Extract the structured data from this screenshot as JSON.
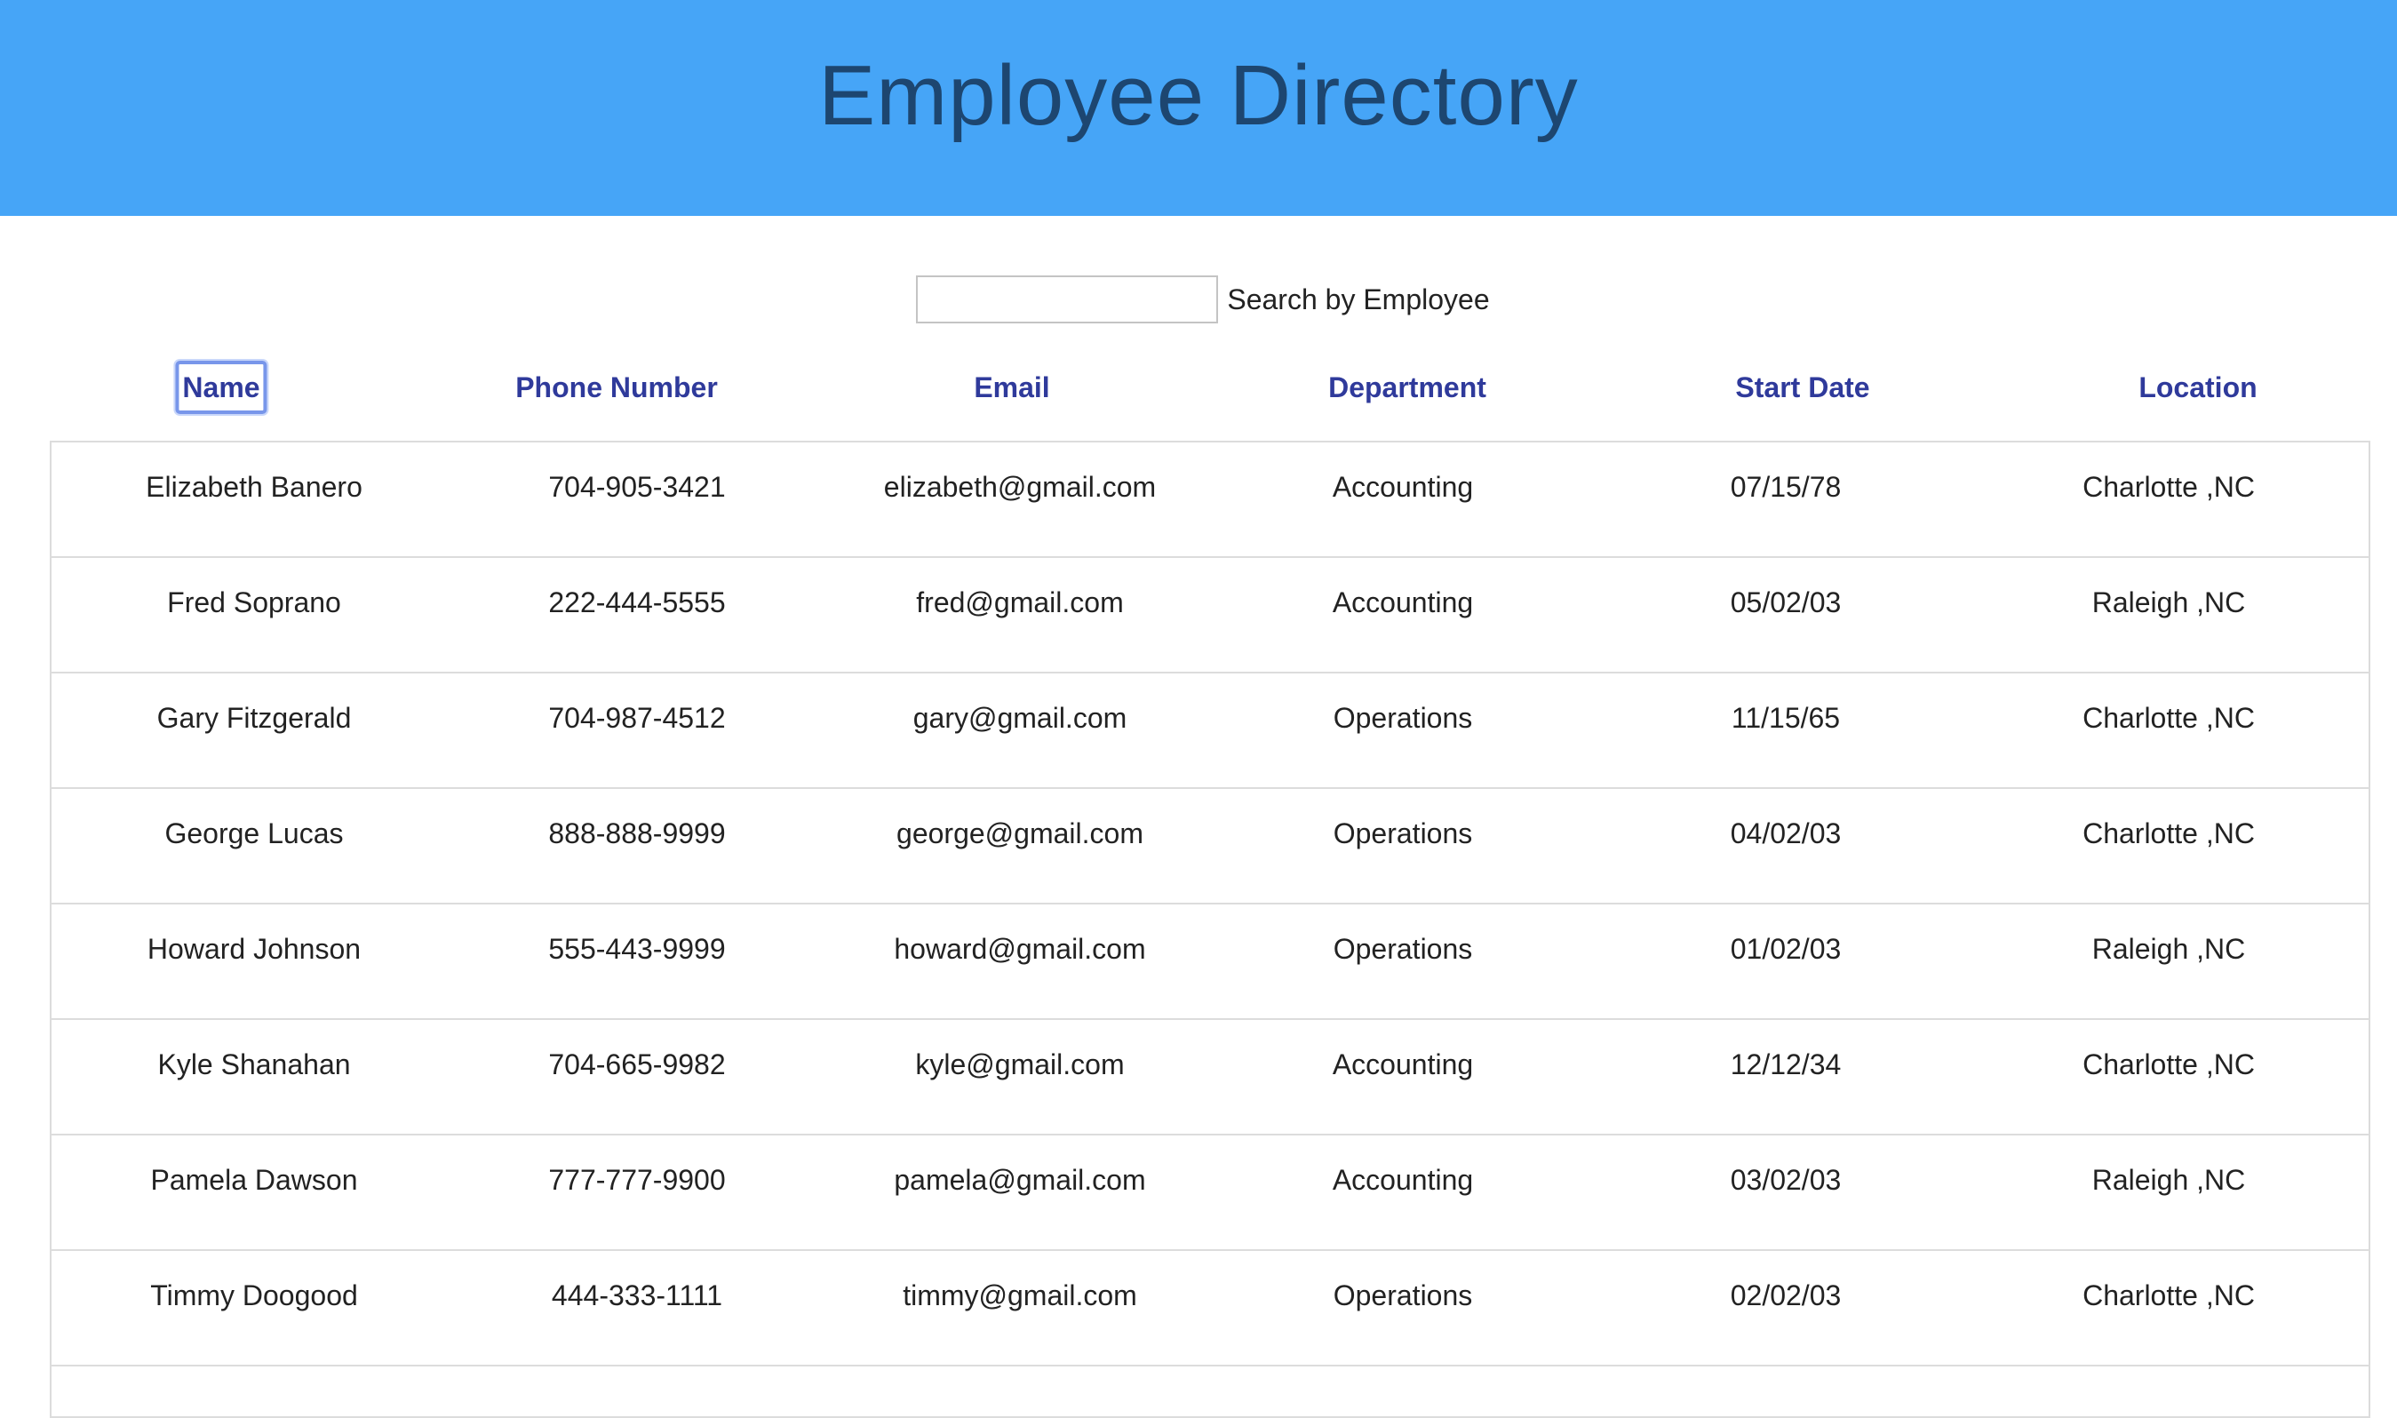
{
  "header": {
    "title": "Employee Directory"
  },
  "search": {
    "value": "",
    "placeholder": "",
    "label": "Search by Employee"
  },
  "table": {
    "columns": [
      "Name",
      "Phone Number",
      "Email",
      "Department",
      "Start Date",
      "Location"
    ],
    "active_sort_column": "Name",
    "rows": [
      [
        "Elizabeth Banero",
        "704-905-3421",
        "elizabeth@gmail.com",
        "Accounting",
        "07/15/78",
        "Charlotte ,NC"
      ],
      [
        "Fred Soprano",
        "222-444-5555",
        "fred@gmail.com",
        "Accounting",
        "05/02/03",
        "Raleigh ,NC"
      ],
      [
        "Gary Fitzgerald",
        "704-987-4512",
        "gary@gmail.com",
        "Operations",
        "11/15/65",
        "Charlotte ,NC"
      ],
      [
        "George Lucas",
        "888-888-9999",
        "george@gmail.com",
        "Operations",
        "04/02/03",
        "Charlotte ,NC"
      ],
      [
        "Howard Johnson",
        "555-443-9999",
        "howard@gmail.com",
        "Operations",
        "01/02/03",
        "Raleigh ,NC"
      ],
      [
        "Kyle Shanahan",
        "704-665-9982",
        "kyle@gmail.com",
        "Accounting",
        "12/12/34",
        "Charlotte ,NC"
      ],
      [
        "Pamela Dawson",
        "777-777-9900",
        "pamela@gmail.com",
        "Accounting",
        "03/02/03",
        "Raleigh ,NC"
      ],
      [
        "Timmy Doogood",
        "444-333-1111",
        "timmy@gmail.com",
        "Operations",
        "02/02/03",
        "Charlotte ,NC"
      ]
    ]
  },
  "colors": {
    "header_bg": "#46a5f7",
    "title_color": "#1d4670",
    "column_header_color": "#2f3a9b",
    "active_outline": "#7896ea"
  }
}
